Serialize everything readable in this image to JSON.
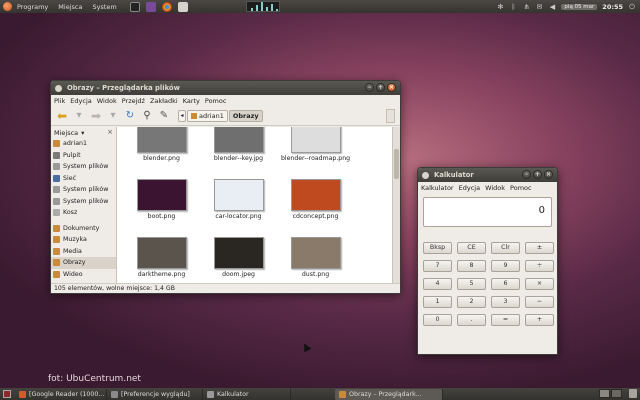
{
  "top_panel": {
    "menus": [
      "Programy",
      "Miejsca",
      "System"
    ],
    "date": "pią 05 mar",
    "time": "20:55"
  },
  "file_manager": {
    "title": "Obrazy – Przeglądarka plików",
    "menu": [
      "Plik",
      "Edycja",
      "Widok",
      "Przejdź",
      "Zakładki",
      "Karty",
      "Pomoc"
    ],
    "breadcrumbs": [
      "adrian1",
      "Obrazy"
    ],
    "sidebar_header": "Miejsca",
    "places": [
      {
        "label": "adrian1",
        "icon": "home-folder-icon",
        "color": "#c98a3a"
      },
      {
        "label": "Pulpit",
        "icon": "desktop-icon",
        "color": "#7a7a7a"
      },
      {
        "label": "System plików",
        "icon": "drive-icon",
        "color": "#999999"
      },
      {
        "label": "Sieć",
        "icon": "network-icon",
        "color": "#4a6fa0"
      },
      {
        "label": "System plików",
        "icon": "drive-icon",
        "color": "#999999"
      },
      {
        "label": "System plików",
        "icon": "drive-icon",
        "color": "#999999"
      },
      {
        "label": "Kosz",
        "icon": "trash-icon",
        "color": "#aaaaaa"
      }
    ],
    "bookmarks": [
      {
        "label": "Dokumenty",
        "icon": "documents-folder-icon",
        "color": "#c98a3a"
      },
      {
        "label": "Muzyka",
        "icon": "music-folder-icon",
        "color": "#c98a3a"
      },
      {
        "label": "Media",
        "icon": "media-folder-icon",
        "color": "#c98a3a"
      },
      {
        "label": "Obrazy",
        "icon": "pictures-folder-icon",
        "color": "#c98a3a",
        "selected": true
      },
      {
        "label": "Wideo",
        "icon": "video-folder-icon",
        "color": "#c98a3a"
      }
    ],
    "files": [
      {
        "name": "blender.png",
        "thumb": "#777777"
      },
      {
        "name": "blender--key.jpg",
        "thumb": "#6f6f6f"
      },
      {
        "name": "blender--roadmap.png",
        "thumb": "#dddddd"
      },
      {
        "name": "boot.png",
        "thumb": "#3a1430"
      },
      {
        "name": "car-locator.png",
        "thumb": "#e8eef4"
      },
      {
        "name": "cdconcept.png",
        "thumb": "#c04a20"
      },
      {
        "name": "darktheme.png",
        "thumb": "#5a544c"
      },
      {
        "name": "doom.jpeg",
        "thumb": "#2a2622"
      },
      {
        "name": "dust.png",
        "thumb": "#8a7a6a"
      },
      {
        "name": "",
        "thumb": "#888888"
      },
      {
        "name": "",
        "thumb": "#aaaaaa"
      },
      {
        "name": "",
        "thumb": "#bbbbbb"
      }
    ],
    "status": "105 elementów, wolne miejsce: 1,4 GB"
  },
  "calculator": {
    "title": "Kalkulator",
    "menu": [
      "Kalkulator",
      "Edycja",
      "Widok",
      "Pomoc"
    ],
    "display": "0",
    "keys": [
      "Bksp",
      "CE",
      "Clr",
      "±",
      "7",
      "8",
      "9",
      "÷",
      "4",
      "5",
      "6",
      "×",
      "1",
      "2",
      "3",
      "−",
      "0",
      ".",
      "=",
      "+"
    ]
  },
  "watermark": "fot: UbuCentrum.net",
  "taskbar": {
    "tasks": [
      {
        "label": "[Google Reader (1000...",
        "color": "#d35a2a",
        "active": false
      },
      {
        "label": "[Preferencje wyglądu]",
        "color": "#8a8a8a",
        "active": false
      },
      {
        "label": "Kalkulator",
        "color": "#9a9a9a",
        "active": false
      },
      {
        "label": "Obrazy – Przeglądark...",
        "color": "#c98a3a",
        "active": true
      }
    ]
  }
}
